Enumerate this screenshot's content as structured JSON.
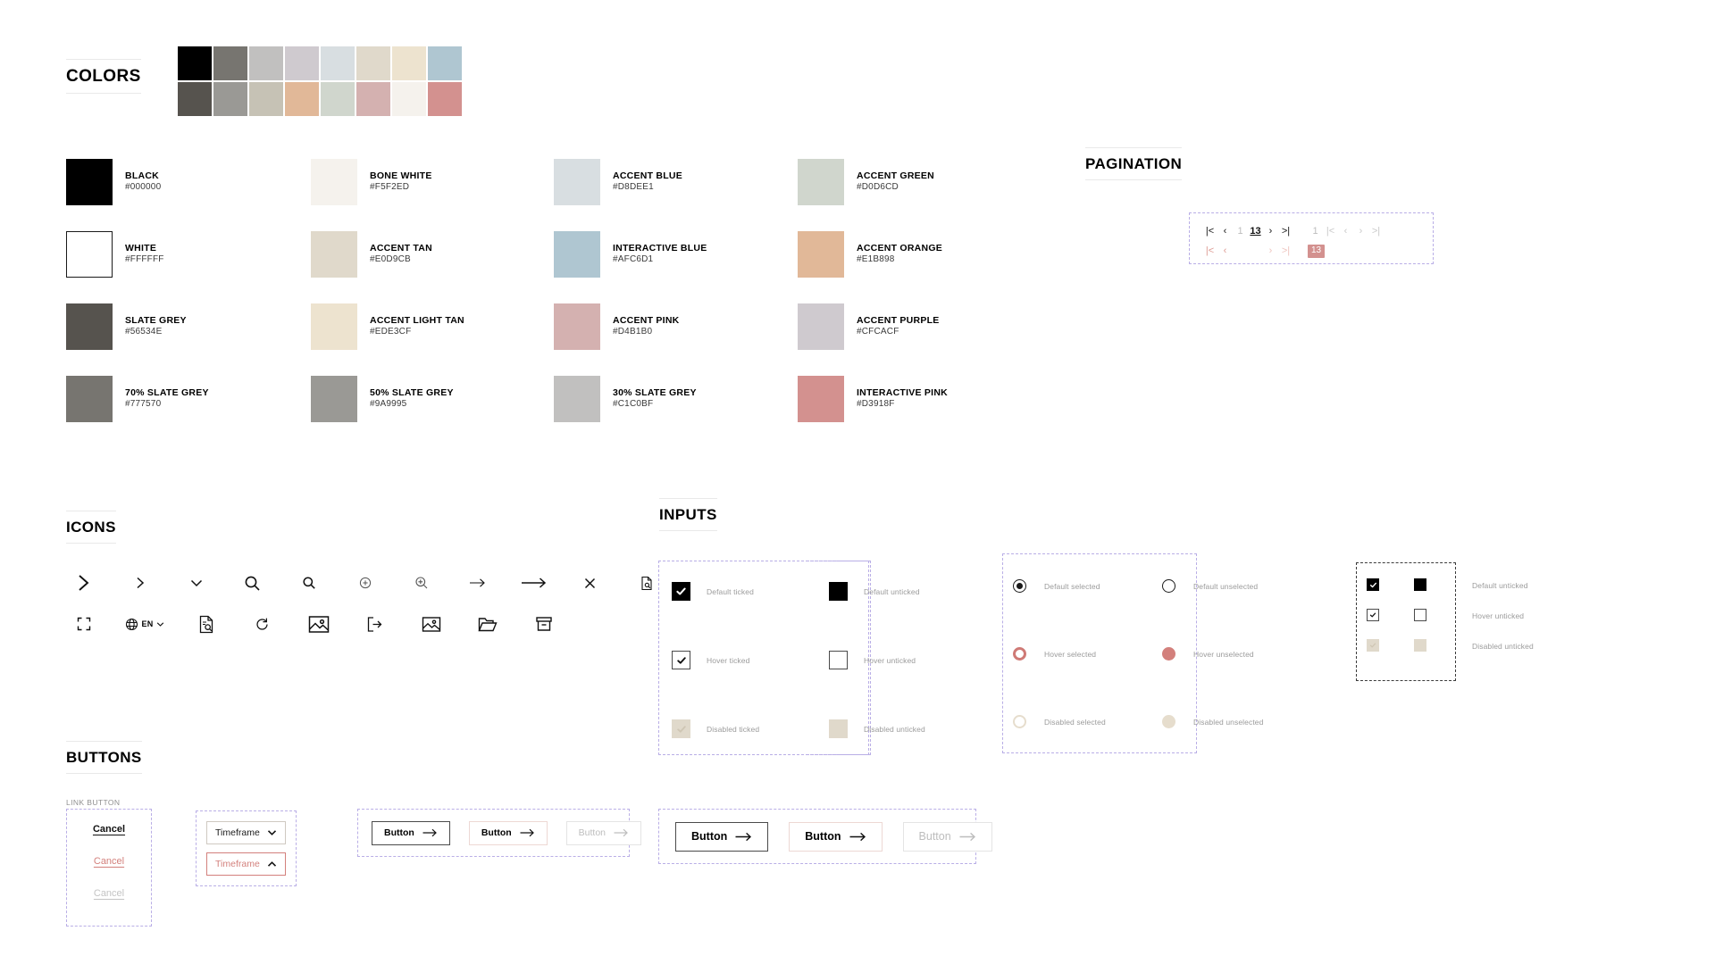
{
  "sections": {
    "colors": {
      "title": "COLORS"
    },
    "pagination": {
      "title": "PAGINATION"
    },
    "icons": {
      "title": "ICONS"
    },
    "inputs": {
      "title": "INPUTS"
    },
    "buttons": {
      "title": "BUTTONS"
    }
  },
  "color_strip": {
    "top": [
      "#000000",
      "#777570",
      "#C1C0BF",
      "#CFCACF",
      "#D8DEE1",
      "#E0D9CB",
      "#EDE3CF",
      "#AFC6D1"
    ],
    "bottom": [
      "#56534E",
      "#9A9995",
      "#C6C2B5",
      "#E1B898",
      "#D0D6CD",
      "#D4B1B0",
      "#F5F2ED",
      "#D3918F"
    ]
  },
  "color_chips": [
    {
      "name": "BLACK",
      "hex": "#000000",
      "swatch": "#000000",
      "bordered": false
    },
    {
      "name": "WHITE",
      "hex": "#FFFFFF",
      "swatch": "#FFFFFF",
      "bordered": true
    },
    {
      "name": "SLATE GREY",
      "hex": "#56534E",
      "swatch": "#56534E",
      "bordered": false
    },
    {
      "name": "70% SLATE GREY",
      "hex": "#777570",
      "swatch": "#777570",
      "bordered": false
    },
    {
      "name": "BONE WHITE",
      "hex": "#F5F2ED",
      "swatch": "#F5F2ED",
      "bordered": false
    },
    {
      "name": "ACCENT TAN",
      "hex": "#E0D9CB",
      "swatch": "#E0D9CB",
      "bordered": false
    },
    {
      "name": "ACCENT LIGHT TAN",
      "hex": "#EDE3CF",
      "swatch": "#EDE3CF",
      "bordered": false
    },
    {
      "name": "50% SLATE GREY",
      "hex": "#9A9995",
      "swatch": "#9A9995",
      "bordered": false
    },
    {
      "name": "ACCENT BLUE",
      "hex": "#D8DEE1",
      "swatch": "#D8DEE1",
      "bordered": false
    },
    {
      "name": "INTERACTIVE BLUE",
      "hex": "#AFC6D1",
      "swatch": "#AFC6D1",
      "bordered": false
    },
    {
      "name": "ACCENT PINK",
      "hex": "#D4B1B0",
      "swatch": "#D4B1B0",
      "bordered": false
    },
    {
      "name": "30% SLATE GREY",
      "hex": "#C1C0BF",
      "swatch": "#C1C0BF",
      "bordered": false
    },
    {
      "name": "ACCENT GREEN",
      "hex": "#D0D6CD",
      "swatch": "#D0D6CD",
      "bordered": false
    },
    {
      "name": "ACCENT ORANGE",
      "hex": "#E1B898",
      "swatch": "#E1B898",
      "bordered": false
    },
    {
      "name": "ACCENT PURPLE",
      "hex": "#CFCACF",
      "swatch": "#CFCACF",
      "bordered": false
    },
    {
      "name": "INTERACTIVE PINK",
      "hex": "#D3918F",
      "swatch": "#D3918F",
      "bordered": false
    }
  ],
  "pagination": {
    "pages": [
      "1",
      "13"
    ],
    "glyphs": {
      "first": "|<",
      "prev": "‹",
      "next": "›",
      "last": ">|"
    }
  },
  "icons": {
    "language_code": "EN",
    "row1": [
      "chevron-right-large",
      "chevron-right",
      "chevron-down",
      "search",
      "search-small",
      "zoom-in-circle",
      "magnifier-plus",
      "arrow-right-small",
      "arrow-right-large",
      "close",
      "document-search-small"
    ],
    "row2": [
      "fullscreen-expand",
      "globe-language",
      "document-search",
      "reset-rotate",
      "image",
      "logout",
      "image-alt",
      "folder-open",
      "archive-box"
    ]
  },
  "inputs": {
    "checkbox_ticked": [
      "Default ticked",
      "Hover ticked",
      "Disabled ticked"
    ],
    "checkbox_unticked": [
      "Default unticked",
      "Hover unticked",
      "Disabled unticked"
    ],
    "radio_selected": [
      "Default selected",
      "Hover selected",
      "Disabled selected"
    ],
    "radio_unselected": [
      "Default unselected",
      "Hover unselected",
      "Disabled unselected"
    ]
  },
  "buttons": {
    "link_group_label": "LINK BUTTON",
    "link_labels": [
      "Cancel",
      "Cancel",
      "Cancel"
    ],
    "dropdown_label": "Timeframe",
    "button_label": "Button"
  }
}
